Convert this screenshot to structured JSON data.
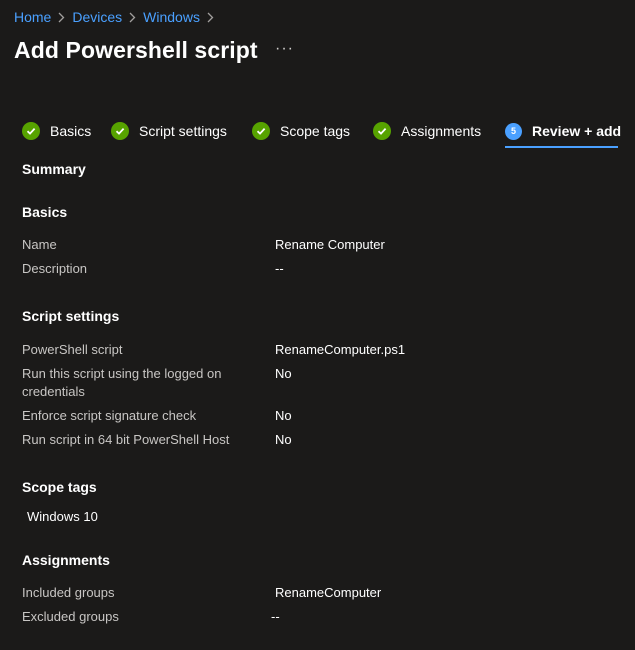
{
  "breadcrumb": [
    "Home",
    "Devices",
    "Windows"
  ],
  "page_title": "Add Powershell script",
  "more_label": "···",
  "steps": [
    {
      "label": "Basics",
      "status": "complete"
    },
    {
      "label": "Script settings",
      "status": "complete"
    },
    {
      "label": "Scope tags",
      "status": "complete"
    },
    {
      "label": "Assignments",
      "status": "complete"
    },
    {
      "label": "Review + add",
      "status": "active",
      "number": "5"
    }
  ],
  "summary_heading": "Summary",
  "basics": {
    "heading": "Basics",
    "rows": [
      {
        "label": "Name",
        "value": "Rename Computer"
      },
      {
        "label": "Description",
        "value": "--"
      }
    ]
  },
  "script_settings": {
    "heading": "Script settings",
    "rows": [
      {
        "label": "PowerShell script",
        "value": "RenameComputer.ps1"
      },
      {
        "label": "Run this script using the logged on credentials",
        "value": "No"
      },
      {
        "label": "Enforce script signature check",
        "value": "No"
      },
      {
        "label": "Run script in 64 bit PowerShell Host",
        "value": "No"
      }
    ]
  },
  "scope_tags": {
    "heading": "Scope tags",
    "tags": [
      "Windows 10"
    ]
  },
  "assignments": {
    "heading": "Assignments",
    "rows": [
      {
        "label": "Included groups",
        "value": "RenameComputer"
      },
      {
        "label": "Excluded groups",
        "value": "--"
      }
    ]
  },
  "colors": {
    "background": "#1b1a19",
    "link": "#4aa0ff",
    "success": "#57a300",
    "accent": "#4aa0ff"
  }
}
